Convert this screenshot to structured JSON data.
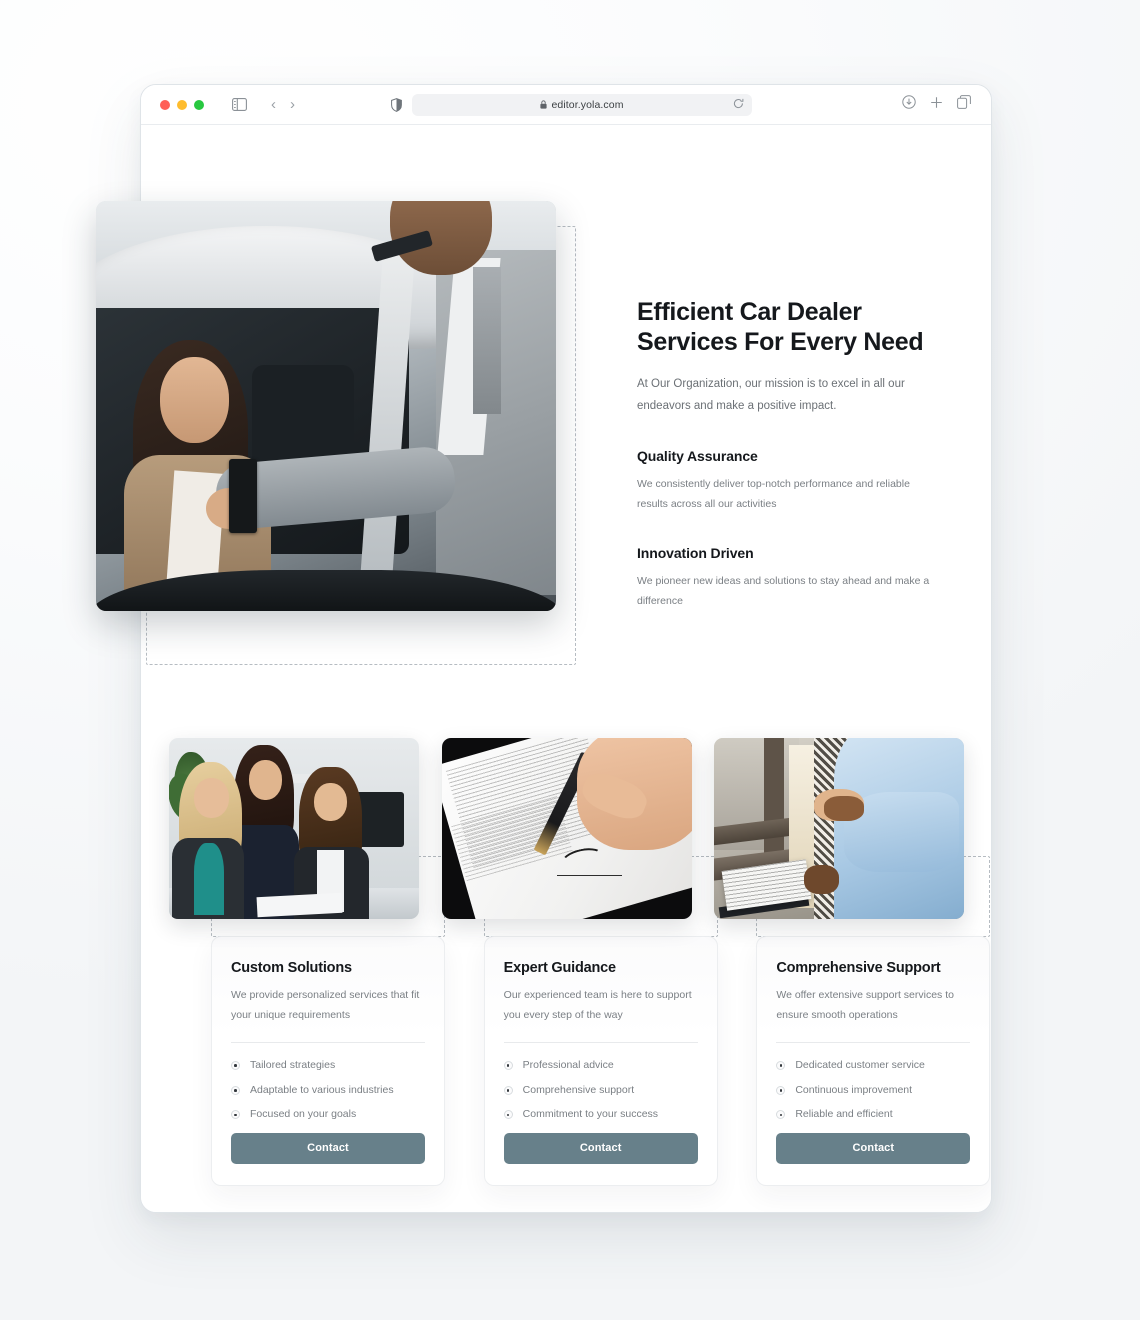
{
  "browser": {
    "url": "editor.yola.com",
    "icons": {
      "sidebar": "sidebar-toggle-icon",
      "back": "back-arrow-icon",
      "forward": "forward-arrow-icon",
      "shield": "shield-icon",
      "lock": "lock-icon",
      "reload": "reload-icon",
      "downloads": "downloads-icon",
      "new_tab": "plus-icon",
      "tab_overview": "tab-overview-icon"
    }
  },
  "hero": {
    "title": "Efficient Car Dealer Services For Every Need",
    "subtitle": "At Our Organization, our mission is to excel in all our endeavors and make a positive impact.",
    "image_alt": "car-dealer-handing-keys-photo",
    "features": [
      {
        "title": "Quality Assurance",
        "body": "We consistently deliver top-notch performance and reliable results across all our activities"
      },
      {
        "title": "Innovation Driven",
        "body": "We pioneer new ideas and solutions to stay ahead and make a difference"
      }
    ]
  },
  "cards": [
    {
      "image_alt": "business-women-meeting-photo",
      "title": "Custom Solutions",
      "description": "We provide personalized services that fit your unique requirements",
      "bullets": [
        "Tailored strategies",
        "Adaptable to various industries",
        "Focused on your goals"
      ],
      "button": "Contact"
    },
    {
      "image_alt": "signing-document-photo",
      "title": "Expert Guidance",
      "description": "Our experienced team is here to support you every step of the way",
      "bullets": [
        "Professional advice",
        "Comprehensive support",
        "Commitment to your success"
      ],
      "button": "Contact"
    },
    {
      "image_alt": "handshake-agreement-photo",
      "title": "Comprehensive Support",
      "description": "We offer extensive support services to ensure smooth operations",
      "bullets": [
        "Dedicated customer service",
        "Continuous improvement",
        "Reliable and efficient"
      ],
      "button": "Contact"
    }
  ],
  "colors": {
    "button": "#67808a",
    "heading": "#15181c",
    "body_text": "#7a7f84",
    "dashed_outline": "#b6bcc2"
  }
}
